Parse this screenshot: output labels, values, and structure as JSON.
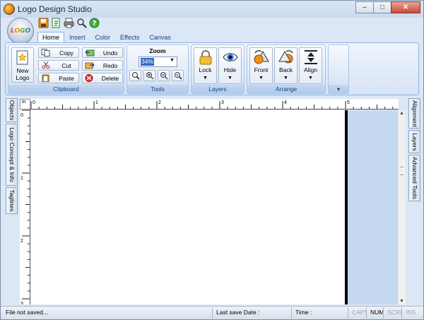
{
  "window": {
    "title": "Logo Design Studio",
    "orb_text": "LOGO"
  },
  "window_controls": {
    "minimize": "–",
    "maximize": "□",
    "close": "✕"
  },
  "tabs": [
    "Home",
    "Insert",
    "Color",
    "Effects",
    "Canvas"
  ],
  "ribbon": {
    "new_logo": {
      "line1": "New",
      "line2": "Logo"
    },
    "clipboard": {
      "label": "Clipboard",
      "copy": "Copy",
      "cut": "Cut",
      "paste": "Paste",
      "undo": "Undo",
      "redo": "Redo",
      "delete": "Delete"
    },
    "tools": {
      "label": "Tools",
      "zoom_title": "Zoom",
      "zoom_value": "34%"
    },
    "layers": {
      "label": "Layers",
      "lock": "Lock",
      "hide": "Hide"
    },
    "arrange": {
      "label": "Arrange",
      "front": "Front",
      "back": "Back",
      "align": "Align"
    }
  },
  "left_tabs": [
    "Objects",
    "Logo Concept & Info",
    "Taglines"
  ],
  "right_tabs": [
    "Alignment",
    "Layers",
    "Advanced Tools"
  ],
  "ruler": {
    "unit": "in",
    "h_labels": [
      "0",
      "1",
      "2",
      "3",
      "4",
      "5"
    ],
    "v_labels": [
      "0",
      "1",
      "2",
      "3"
    ]
  },
  "status": {
    "file": "File not saved...",
    "last_save": "Last save Date :",
    "time": "Time :",
    "caps": "CAPS",
    "num": "NUM",
    "scrl": "SCRL",
    "ins": "INS"
  },
  "colors": {
    "accent": "#15428b",
    "ribbon_border": "#8db2e3",
    "canvas_bg": "#c5d9f3"
  }
}
